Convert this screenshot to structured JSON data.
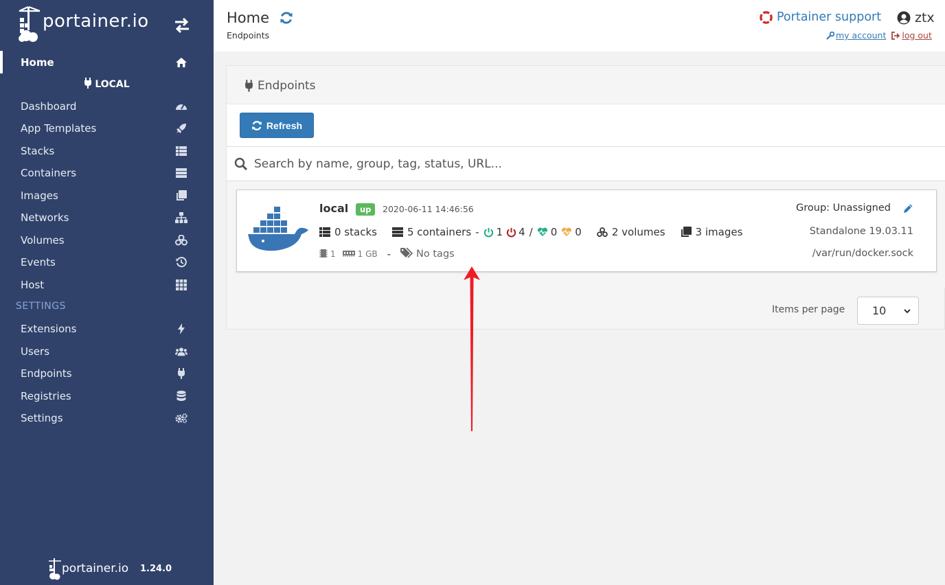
{
  "sidebar": {
    "brand": "portainer.io",
    "home_label": "Home",
    "endpoint_name": "LOCAL",
    "items": [
      {
        "label": "Dashboard",
        "icon": "tachometer-icon"
      },
      {
        "label": "App Templates",
        "icon": "rocket-icon"
      },
      {
        "label": "Stacks",
        "icon": "th-list-icon"
      },
      {
        "label": "Containers",
        "icon": "server-icon"
      },
      {
        "label": "Images",
        "icon": "clone-icon"
      },
      {
        "label": "Networks",
        "icon": "sitemap-icon"
      },
      {
        "label": "Volumes",
        "icon": "cubes-icon"
      },
      {
        "label": "Events",
        "icon": "history-icon"
      },
      {
        "label": "Host",
        "icon": "th-icon"
      }
    ],
    "settings_heading": "SETTINGS",
    "settings_items": [
      {
        "label": "Extensions",
        "icon": "bolt-icon"
      },
      {
        "label": "Users",
        "icon": "users-icon"
      },
      {
        "label": "Endpoints",
        "icon": "plug-icon"
      },
      {
        "label": "Registries",
        "icon": "database-icon"
      },
      {
        "label": "Settings",
        "icon": "cogs-icon"
      }
    ],
    "footer_brand": "portainer.io",
    "version": "1.24.0"
  },
  "header": {
    "title": "Home",
    "breadcrumb": "Endpoints",
    "support_label": "Portainer support",
    "username": "ztx",
    "my_account": "my account",
    "log_out": "log out"
  },
  "panel": {
    "title": "Endpoints",
    "refresh_label": "Refresh",
    "search_placeholder": "Search by name, group, tag, status, URL...",
    "items_per_page_label": "Items per page",
    "items_per_page_value": "10"
  },
  "endpoint": {
    "name": "local",
    "status": "up",
    "timestamp": "2020-06-11 14:46:56",
    "stacks": "0 stacks",
    "containers": "5 containers",
    "dash": "-",
    "running": "1",
    "stopped": "4",
    "slash": "/",
    "healthy": "0",
    "unhealthy": "0",
    "volumes": "2 volumes",
    "images": "3 images",
    "cpu": "1",
    "memory": "1 GB",
    "tags": "No tags",
    "group": "Group: Unassigned",
    "version": "Standalone 19.03.11",
    "url": "/var/run/docker.sock"
  },
  "colors": {
    "sidebar_bg": "#30426a",
    "primary": "#337ab7",
    "status_up": "#5cb85c",
    "running": "#23ae89",
    "stopped": "#ae2323",
    "unhealthy": "#f0ad4e",
    "annotation_arrow": "#ee1c25"
  }
}
